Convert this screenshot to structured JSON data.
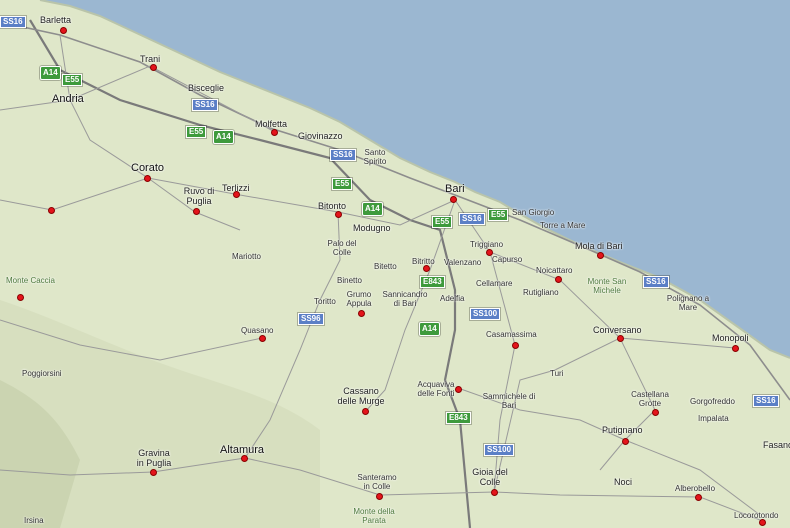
{
  "map": {
    "colors": {
      "land": "#dfe7c9",
      "sea": "#9bb7d1",
      "road": "#8d8d8d",
      "motorway": "#6e6e6e",
      "dot": "#e4141b"
    },
    "cities": [
      {
        "name": "Barletta",
        "cls": "mid"
      },
      {
        "name": "Trani",
        "cls": "mid"
      },
      {
        "name": "Bisceglie",
        "cls": "mid"
      },
      {
        "name": "Andria",
        "cls": "big"
      },
      {
        "name": "Molfetta",
        "cls": "mid"
      },
      {
        "name": "Giovinazzo",
        "cls": "mid"
      },
      {
        "name": "Corato",
        "cls": "big"
      },
      {
        "name": "Ruvo di Puglia",
        "cls": "mid"
      },
      {
        "name": "Terlizzi",
        "cls": "mid"
      },
      {
        "name": "Santo Spirito",
        "cls": "small"
      },
      {
        "name": "Bari",
        "cls": "big"
      },
      {
        "name": "Bitonto",
        "cls": "mid"
      },
      {
        "name": "Modugno",
        "cls": "mid"
      },
      {
        "name": "San Giorgio",
        "cls": "small"
      },
      {
        "name": "Torre a Mare",
        "cls": "small"
      },
      {
        "name": "Triggiano",
        "cls": "small"
      },
      {
        "name": "Mola di Bari",
        "cls": "mid"
      },
      {
        "name": "Palo del Colle",
        "cls": "small"
      },
      {
        "name": "Mariotto",
        "cls": "small"
      },
      {
        "name": "Binetto",
        "cls": "small"
      },
      {
        "name": "Bitetto",
        "cls": "small"
      },
      {
        "name": "Bitritto",
        "cls": "small"
      },
      {
        "name": "Valenzano",
        "cls": "small"
      },
      {
        "name": "Capurso",
        "cls": "small"
      },
      {
        "name": "Noicattaro",
        "cls": "small"
      },
      {
        "name": "Cellamare",
        "cls": "small"
      },
      {
        "name": "Rutigliano",
        "cls": "small"
      },
      {
        "name": "Polignano a Mare",
        "cls": "small"
      },
      {
        "name": "Toritto",
        "cls": "small"
      },
      {
        "name": "Grumo Appula",
        "cls": "small"
      },
      {
        "name": "Sannicandro di Bari",
        "cls": "small"
      },
      {
        "name": "Adelfia",
        "cls": "small"
      },
      {
        "name": "Quasano",
        "cls": "small"
      },
      {
        "name": "Casamassima",
        "cls": "small"
      },
      {
        "name": "Conversano",
        "cls": "mid"
      },
      {
        "name": "Monopoli",
        "cls": "mid"
      },
      {
        "name": "Poggiorsini",
        "cls": "small"
      },
      {
        "name": "Turi",
        "cls": "small"
      },
      {
        "name": "Cassano delle Murge",
        "cls": "mid"
      },
      {
        "name": "Acquaviva delle Fonti",
        "cls": "small"
      },
      {
        "name": "Sammichele di Bari",
        "cls": "small"
      },
      {
        "name": "Castellana Grotte",
        "cls": "small"
      },
      {
        "name": "Gorgofreddo",
        "cls": "small"
      },
      {
        "name": "Impalata",
        "cls": "small"
      },
      {
        "name": "Putignano",
        "cls": "mid"
      },
      {
        "name": "Fasano",
        "cls": "mid"
      },
      {
        "name": "Gravina in Puglia",
        "cls": "mid"
      },
      {
        "name": "Altamura",
        "cls": "big"
      },
      {
        "name": "Santeramo in Colle",
        "cls": "small"
      },
      {
        "name": "Gioia del Colle",
        "cls": "mid"
      },
      {
        "name": "Noci",
        "cls": "mid"
      },
      {
        "name": "Alberobello",
        "cls": "small"
      },
      {
        "name": "Locorotondo",
        "cls": "small"
      },
      {
        "name": "Irsina",
        "cls": "small"
      }
    ],
    "terrain_labels": [
      "Monte Caccia",
      "Monte San Michele",
      "Monte della Parata"
    ],
    "road_shields": [
      {
        "text": "SS16",
        "type": "blue"
      },
      {
        "text": "SS16",
        "type": "blue"
      },
      {
        "text": "SS16",
        "type": "blue"
      },
      {
        "text": "SS16",
        "type": "blue"
      },
      {
        "text": "SS16",
        "type": "blue"
      },
      {
        "text": "SS16",
        "type": "blue"
      },
      {
        "text": "SS96",
        "type": "blue"
      },
      {
        "text": "SS100",
        "type": "blue"
      },
      {
        "text": "SS100",
        "type": "blue"
      },
      {
        "text": "A14",
        "type": "motorway"
      },
      {
        "text": "A14",
        "type": "motorway"
      },
      {
        "text": "A14",
        "type": "motorway"
      },
      {
        "text": "A14",
        "type": "motorway"
      },
      {
        "text": "E55",
        "type": "green"
      },
      {
        "text": "E55",
        "type": "green"
      },
      {
        "text": "E55",
        "type": "green"
      },
      {
        "text": "E55",
        "type": "green"
      },
      {
        "text": "E55",
        "type": "green"
      },
      {
        "text": "E843",
        "type": "green"
      },
      {
        "text": "E843",
        "type": "green"
      }
    ]
  }
}
